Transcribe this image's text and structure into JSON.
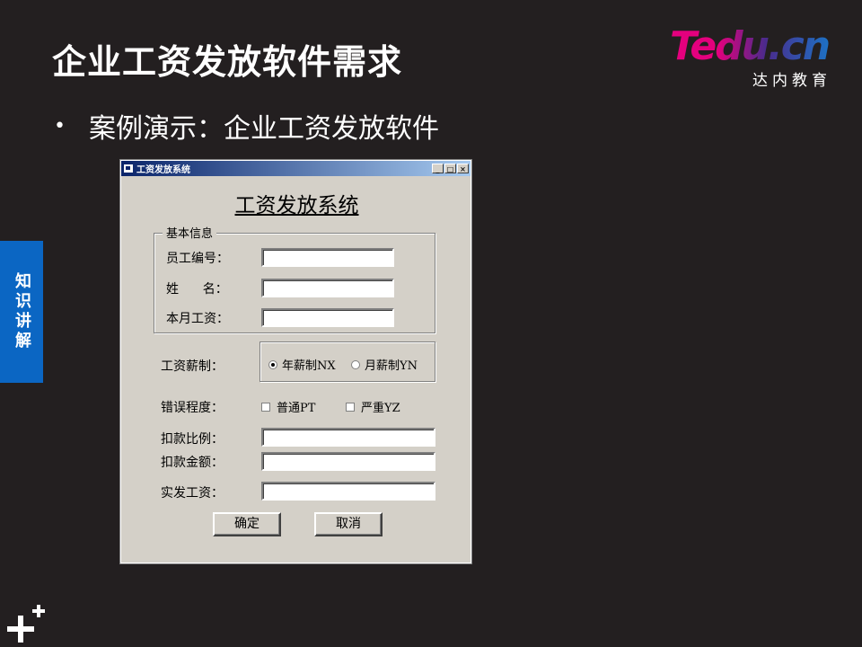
{
  "slide": {
    "title": "企业工资发放软件需求",
    "bullet": "案例演示：企业工资发放软件",
    "side_tab": "知识讲解",
    "logo_main": "Tedu.cn",
    "logo_sub": "达内教育"
  },
  "window": {
    "title": "工资发放系统",
    "heading": "工资发放系统",
    "group_label": "基本信息",
    "fields": {
      "employee_id_label": "员工编号：",
      "name_label": "姓      名：",
      "monthly_salary_label": "本月工资：",
      "employee_id_value": "",
      "name_value": "",
      "monthly_salary_value": ""
    },
    "salary_system": {
      "label": "工资薪制：",
      "option_year": "年薪制NX",
      "option_month": "月薪制YN",
      "selected": "年薪制NX"
    },
    "error_level": {
      "label": "错误程度：",
      "option_normal": "普通PT",
      "option_severe": "严重YZ"
    },
    "deduction_ratio_label": "扣款比例：",
    "deduction_amount_label": "扣款金额：",
    "actual_salary_label": "实发工资：",
    "deduction_ratio_value": "",
    "deduction_amount_value": "",
    "actual_salary_value": "",
    "ok_button": "确定",
    "cancel_button": "取消",
    "titlebar_buttons": [
      "_",
      "□",
      "×"
    ]
  },
  "colors": {
    "background": "#231f20",
    "side_tab": "#0b66c3",
    "dialog_face": "#d4d0c8",
    "titlebar_start": "#0a246a"
  }
}
